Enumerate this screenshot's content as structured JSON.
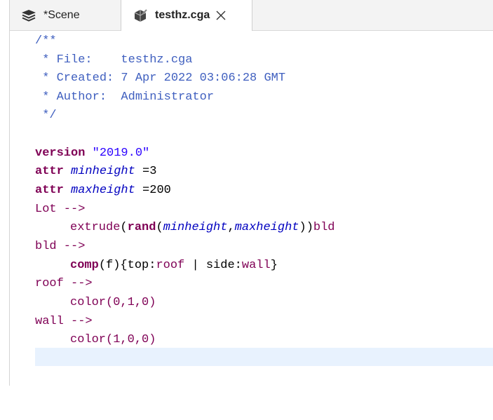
{
  "tabs": [
    {
      "label": "*Scene",
      "icon": "layers-icon"
    },
    {
      "label": "testhz.cga",
      "icon": "cga-rule-icon",
      "active": true
    }
  ],
  "code": {
    "comment": [
      "/**",
      " * File:    testhz.cga",
      " * Created: 7 Apr 2022 03:06:28 GMT",
      " * Author:  Administrator",
      " */"
    ],
    "version_kw": "version",
    "version_val": "\"2019.0\"",
    "attr1_kw": "attr",
    "attr1_name": "minheight",
    "attr1_val": " =3",
    "attr2_kw": "attr",
    "attr2_name": "maxheight",
    "attr2_val": " =200",
    "lot_rule": "Lot -->",
    "extrude_fn": "extrude",
    "extrude_open": "(",
    "rand_fn": "rand",
    "rand_open": "(",
    "rand_arg1": "minheight",
    "rand_comma": ",",
    "rand_arg2": "maxheight",
    "rand_close": "))",
    "extrude_succ": "bld",
    "bld_rule": "bld -->",
    "comp_fn": "comp",
    "comp_args": "(f){",
    "comp_top": "top",
    "comp_colon1": ":",
    "comp_roof": "roof",
    "comp_sep": " | ",
    "comp_side": "side",
    "comp_colon2": ":",
    "comp_wall": "wall",
    "comp_end": "}",
    "roof_rule": "roof -->",
    "roof_color": "color(0,1,0)",
    "wall_rule": "wall -->",
    "wall_color": "color(1,0,0)"
  },
  "colors": {
    "comment": "#3f5fbf",
    "keyword": "#7f0055",
    "string": "#2a00ff",
    "attribute": "#0000c0",
    "current_line": "#e8f2fe"
  }
}
